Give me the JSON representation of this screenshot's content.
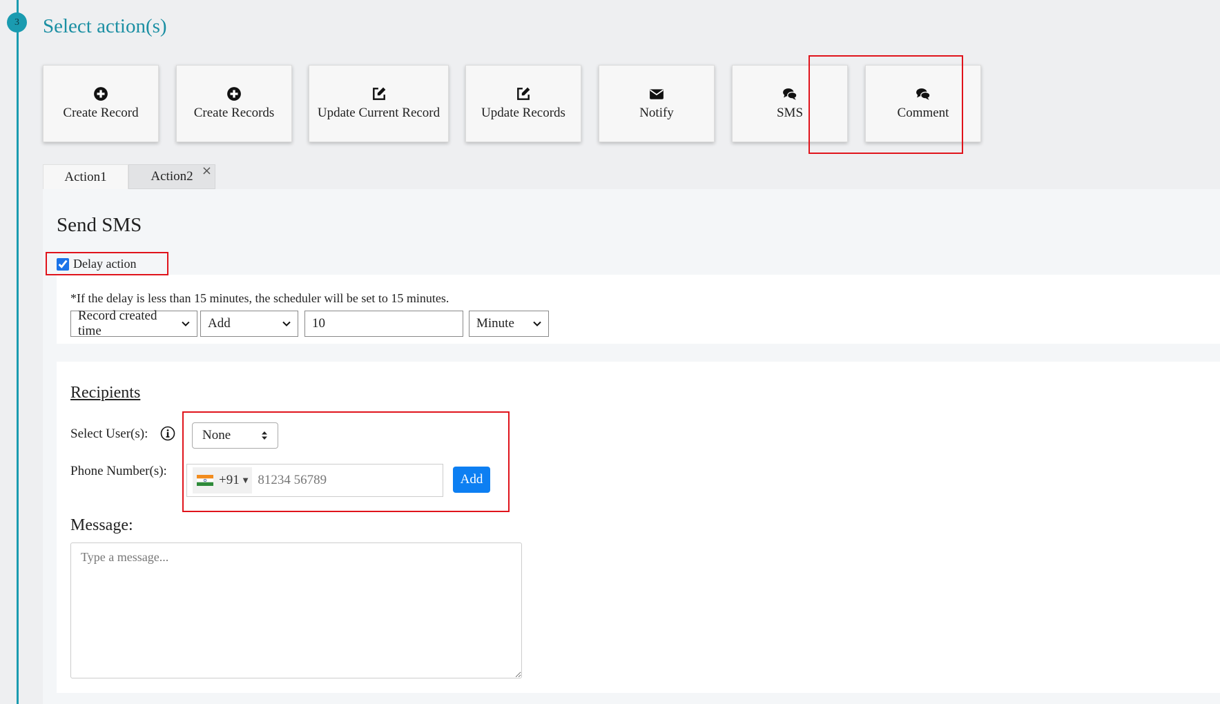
{
  "step": {
    "number": "3",
    "title": "Select action(s)"
  },
  "actions": [
    {
      "label": "Create Record",
      "icon": "plus-circle-icon"
    },
    {
      "label": "Create Records",
      "icon": "plus-circle-icon"
    },
    {
      "label": "Update Current Record",
      "icon": "edit-icon"
    },
    {
      "label": "Update Records",
      "icon": "edit-icon"
    },
    {
      "label": "Notify",
      "icon": "envelope-icon"
    },
    {
      "label": "SMS",
      "icon": "comments-icon"
    },
    {
      "label": "Comment",
      "icon": "comments-icon"
    }
  ],
  "tabs": [
    {
      "label": "Action1"
    },
    {
      "label": "Action2",
      "close": "×"
    }
  ],
  "form": {
    "title": "Send SMS",
    "delay": {
      "checkbox_label": "Delay action",
      "checked": true,
      "note": "*If the delay is less than 15 minutes, the scheduler will be set to 15 minutes.",
      "base": "Record created time",
      "operation": "Add",
      "amount": "10",
      "unit": "Minute"
    },
    "recipients": {
      "title": "Recipients",
      "select_users_label": "Select User(s):",
      "select_users_value": "None",
      "phone_label": "Phone Number(s):",
      "country_code": "+91",
      "phone_placeholder": "81234 56789",
      "add_label": "Add"
    },
    "message": {
      "label": "Message:",
      "placeholder": "Type a message..."
    }
  },
  "colors": {
    "accent": "#1a9bb0",
    "highlight": "#e0131b",
    "button": "#0d7ff2"
  }
}
